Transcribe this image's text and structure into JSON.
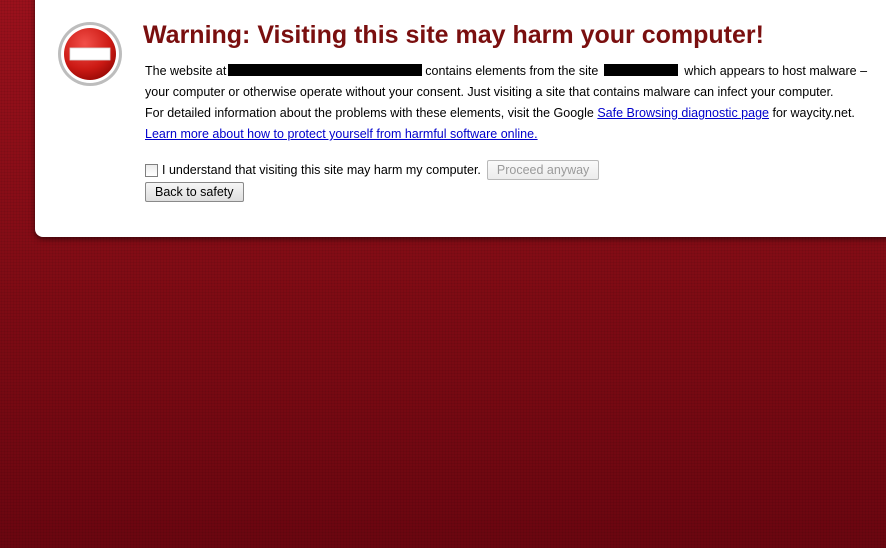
{
  "warning": {
    "title": "Warning: Visiting this site may harm your computer!",
    "icon": "stop-sign-icon",
    "accent_color": "#7a0f0f",
    "background_color": "#8b0e18"
  },
  "message": {
    "line1_prefix": "The website at",
    "line1_middle": "contains elements from the site",
    "line1_suffix": "which appears to host malware –",
    "line2": "your computer or otherwise operate without your consent. Just visiting a site that contains malware can infect your computer.",
    "line3_prefix": "For detailed information about the problems with these elements, visit the Google",
    "line3_link": "Safe Browsing diagnostic page",
    "line3_suffix": "for waycity.net.",
    "learn_more_link": "Learn more about how to protect yourself from harmful software online."
  },
  "controls": {
    "checkbox_label": "I understand that visiting this site may harm my computer.",
    "proceed_button": "Proceed anyway",
    "back_button": "Back to safety"
  }
}
